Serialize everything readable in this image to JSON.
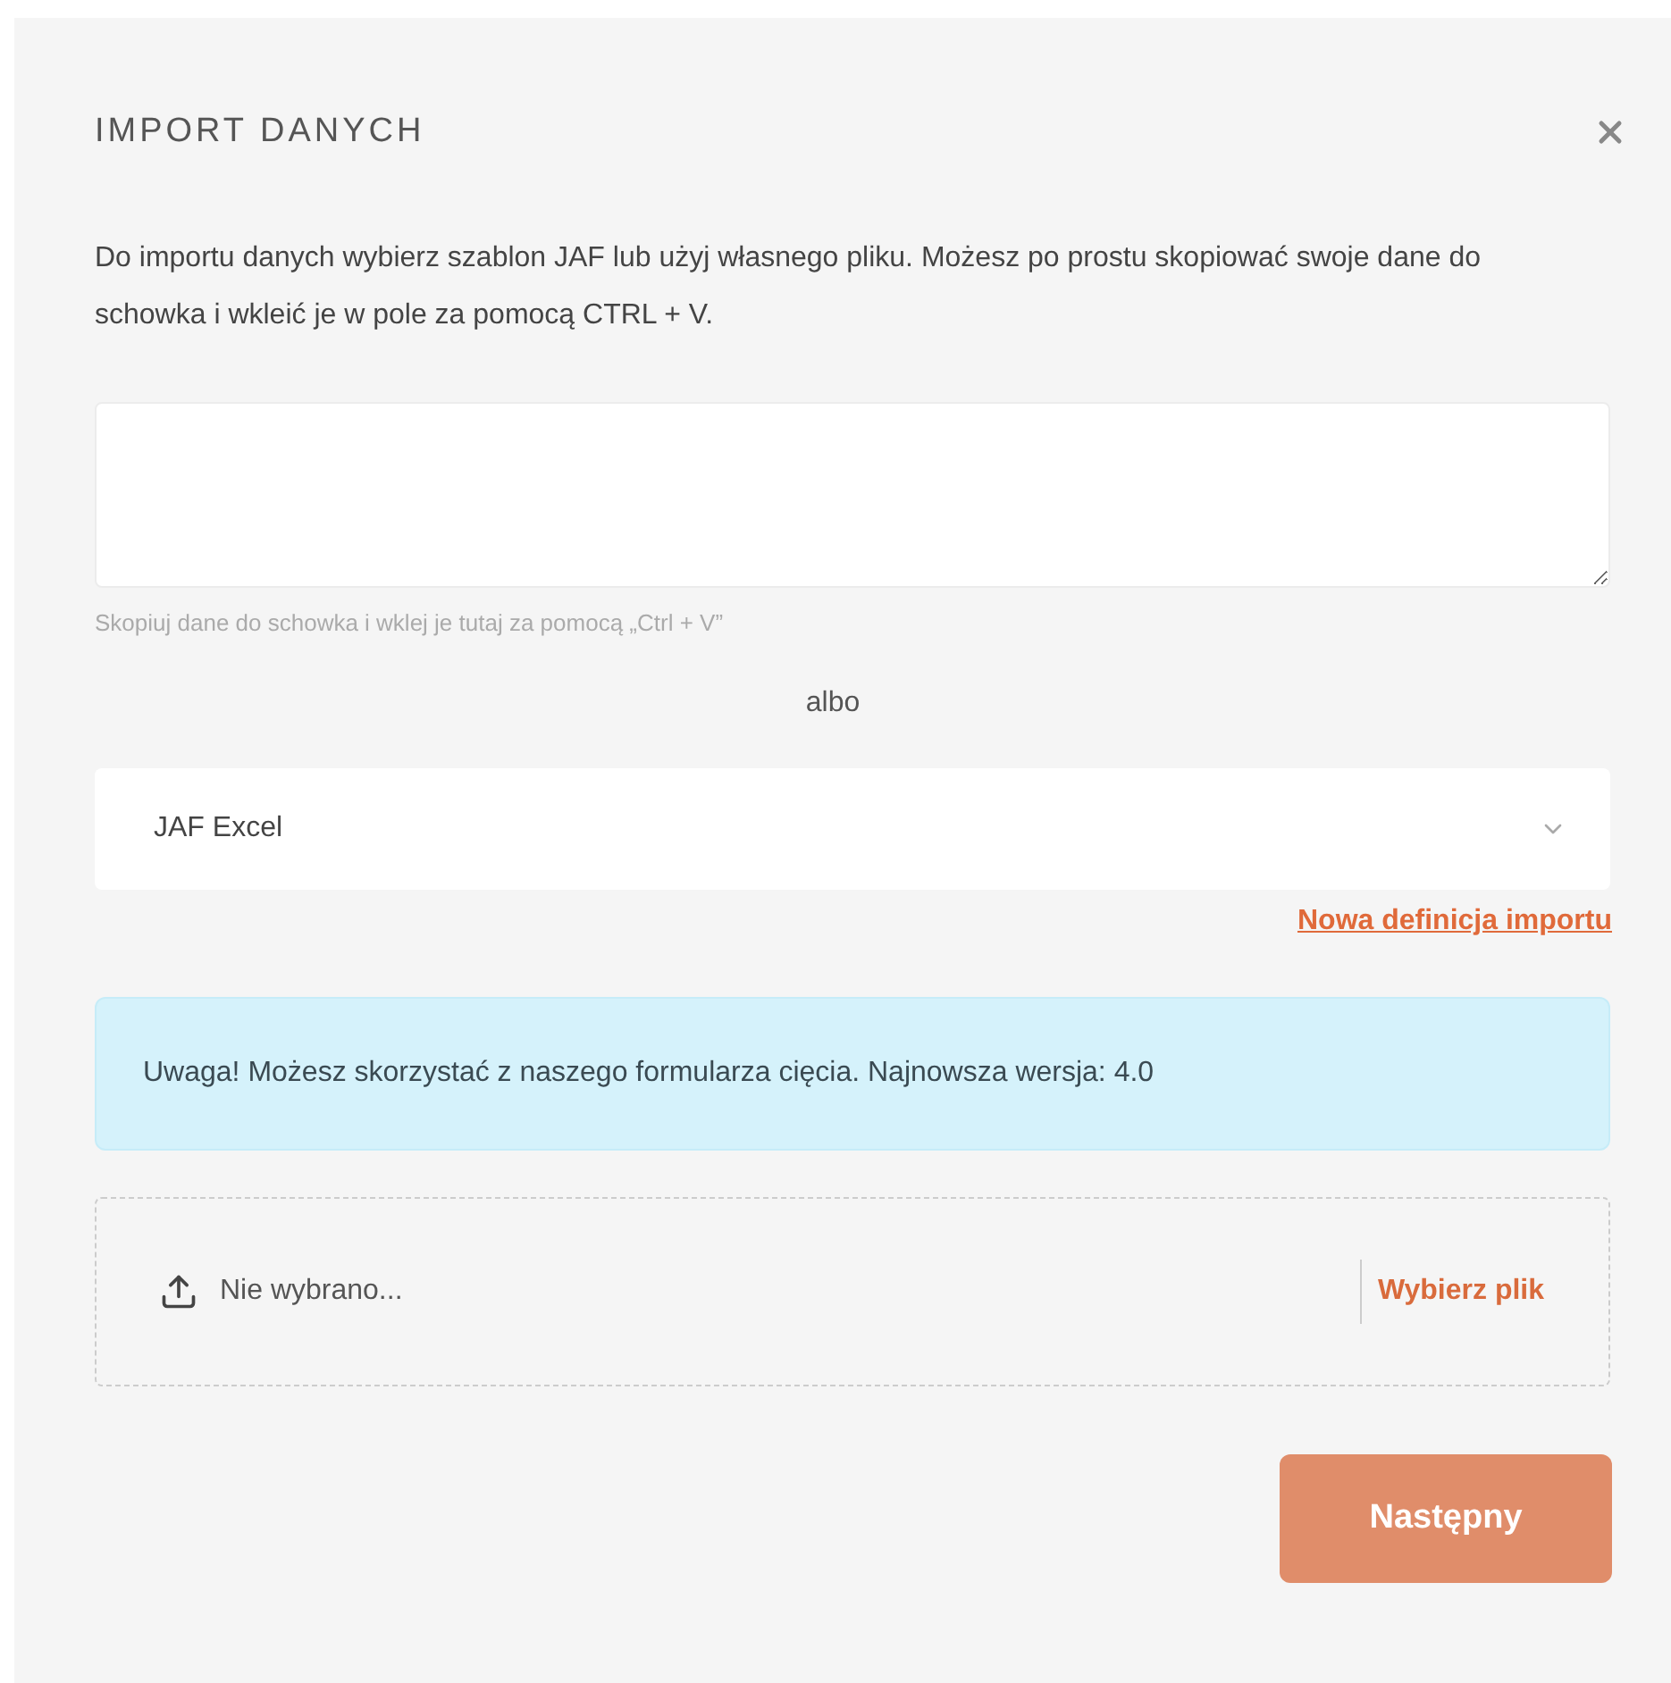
{
  "dialog": {
    "title": "IMPORT DANYCH",
    "intro": "Do importu danych wybierz szablon JAF lub użyj własnego pliku. Możesz po prostu skopiować swoje dane do schowka i wkleić je w pole za pomocą CTRL + V."
  },
  "paste_field": {
    "hint": "Skopiuj dane do schowka i wklej je tutaj za pomocą „Ctrl + V”"
  },
  "separator": "albo",
  "template_select": {
    "value": "JAF Excel"
  },
  "new_definition_link": "Nowa definicja importu",
  "notice": "Uwaga! Możesz skorzystać z naszego formularza cięcia. Najnowsza wersja: 4.0",
  "file_picker": {
    "status": "Nie wybrano...",
    "button": "Wybierz plik"
  },
  "next_button": {
    "label": "Następny",
    "disabled": true
  }
}
